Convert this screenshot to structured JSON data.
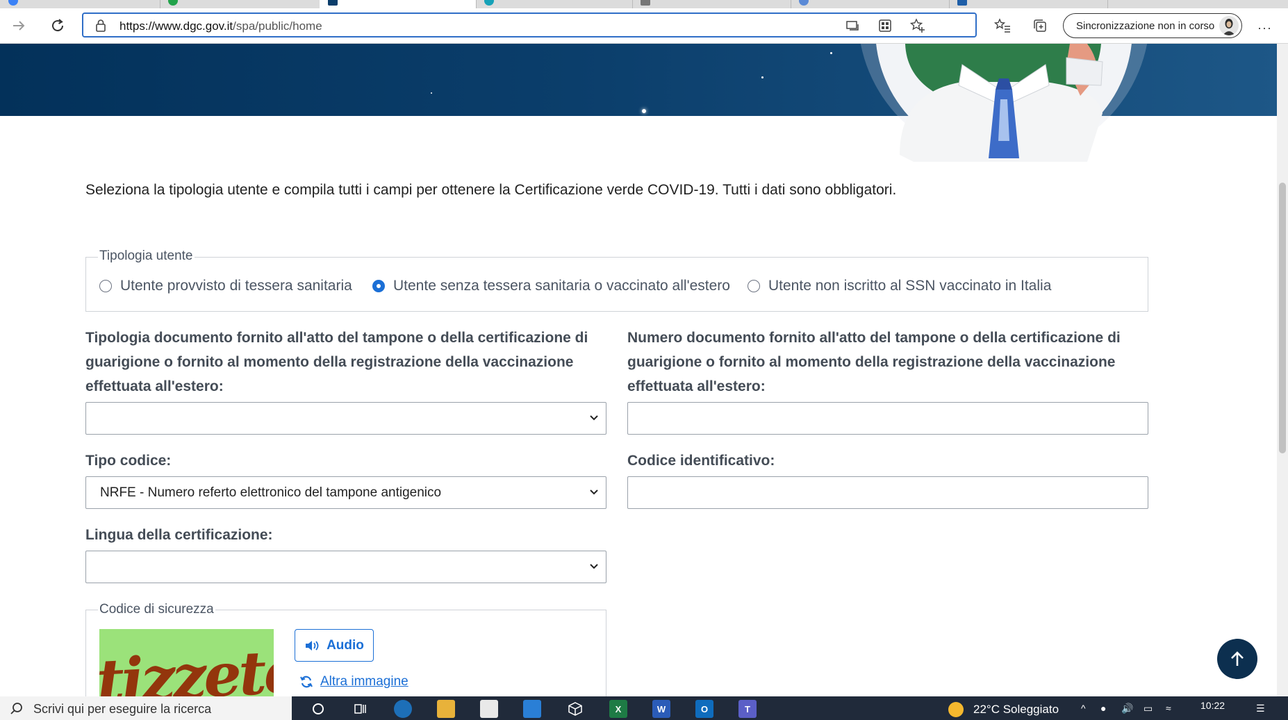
{
  "browser": {
    "url_host": "https://www.dgc.gov.it",
    "url_path": "/spa/public/home",
    "sync_label": "Sincronizzazione non in corso"
  },
  "page": {
    "intro": "Seleziona la tipologia utente e compila tutti i campi per ottenere la Certificazione verde COVID-19. Tutti i dati sono obbligatori.",
    "user_type": {
      "legend": "Tipologia utente",
      "options": [
        "Utente provvisto di tessera sanitaria",
        "Utente senza tessera sanitaria o vaccinato all'estero",
        "Utente non iscritto al SSN vaccinato in Italia"
      ],
      "selected": 1
    },
    "doc_type": {
      "label_line1": "Tipologia documento fornito all'atto del tampone o della certificazione di",
      "label_line2": "guarigione o fornito al momento della registrazione della vaccinazione",
      "label_line3": "effettuata all'estero:",
      "value": ""
    },
    "doc_number": {
      "label_line1": "Numero documento fornito all'atto del tampone o della certificazione di",
      "label_line2": "guarigione o fornito al momento della registrazione della vaccinazione",
      "label_line3": "effettuata all'estero:",
      "value": ""
    },
    "code_type": {
      "label": "Tipo codice:",
      "value": "NRFE - Numero referto elettronico del tampone antigenico"
    },
    "code_id": {
      "label": "Codice identificativo:",
      "value": ""
    },
    "language": {
      "label": "Lingua della certificazione:",
      "value": ""
    },
    "captcha": {
      "legend": "Codice di sicurezza",
      "image_text": "tizzete",
      "audio_label": "Audio",
      "refresh_label": "Altra immagine"
    }
  },
  "taskbar": {
    "search_placeholder": "Scrivi qui per eseguire la ricerca",
    "weather": "22°C  Soleggiato",
    "time": "10:22"
  },
  "colors": {
    "accent": "#1b6fd6",
    "hero": "#0b3e6b",
    "back_to_top": "#0c2f4f"
  }
}
